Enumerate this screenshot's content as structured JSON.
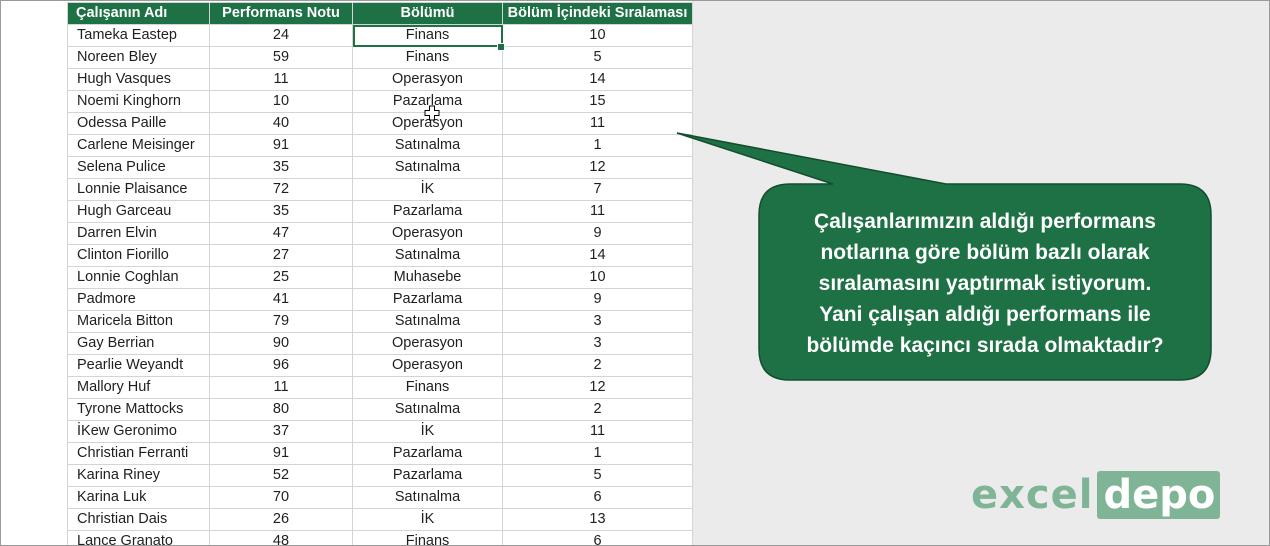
{
  "table": {
    "headers": [
      "Çalışanın Adı",
      "Performans Notu",
      "Bölümü",
      "Bölüm İçindeki Sıralaması"
    ],
    "rows": [
      [
        "Tameka Eastep",
        "24",
        "Finans",
        "10"
      ],
      [
        "Noreen Bley",
        "59",
        "Finans",
        "5"
      ],
      [
        "Hugh Vasques",
        "11",
        "Operasyon",
        "14"
      ],
      [
        "Noemi Kinghorn",
        "10",
        "Pazarlama",
        "15"
      ],
      [
        "Odessa Paille",
        "40",
        "Operasyon",
        "11"
      ],
      [
        "Carlene Meisinger",
        "91",
        "Satınalma",
        "1"
      ],
      [
        "Selena Pulice",
        "35",
        "Satınalma",
        "12"
      ],
      [
        "Lonnie Plaisance",
        "72",
        "İK",
        "7"
      ],
      [
        "Hugh Garceau",
        "35",
        "Pazarlama",
        "11"
      ],
      [
        "Darren Elvin",
        "47",
        "Operasyon",
        "9"
      ],
      [
        "Clinton Fiorillo",
        "27",
        "Satınalma",
        "14"
      ],
      [
        "Lonnie Coghlan",
        "25",
        "Muhasebe",
        "10"
      ],
      [
        "Padmore",
        "41",
        "Pazarlama",
        "9"
      ],
      [
        "Maricela Bitton",
        "79",
        "Satınalma",
        "3"
      ],
      [
        "Gay Berrian",
        "90",
        "Operasyon",
        "3"
      ],
      [
        "Pearlie Weyandt",
        "96",
        "Operasyon",
        "2"
      ],
      [
        "Mallory Huf",
        "11",
        "Finans",
        "12"
      ],
      [
        "Tyrone Mattocks",
        "80",
        "Satınalma",
        "2"
      ],
      [
        "İKew Geronimo",
        "37",
        "İK",
        "11"
      ],
      [
        "Christian Ferranti",
        "91",
        "Pazarlama",
        "1"
      ],
      [
        "Karina Riney",
        "52",
        "Pazarlama",
        "5"
      ],
      [
        "Karina Luk",
        "70",
        "Satınalma",
        "6"
      ],
      [
        "Christian Dais",
        "26",
        "İK",
        "13"
      ],
      [
        "Lance Granato",
        "48",
        "Finans",
        "6"
      ]
    ],
    "selected_row": 0,
    "selected_col": 2
  },
  "callout": {
    "text": "Çalışanlarımızın aldığı performans\nnotlarına göre bölüm bazlı olarak\nsıralamasını yaptırmak istiyorum.\nYani çalışan aldığı performans ile\nbölümde kaçıncı sırada olmaktadır?",
    "fill": "#1e7145",
    "stroke": "#134d2e"
  },
  "logo": {
    "part1": "excel",
    "part2": "depo",
    "color": "#7fb596"
  },
  "colors": {
    "header_bg": "#1e7145",
    "grid": "#d4d4d4",
    "outside_bg": "#ebebeb"
  },
  "icons": {
    "cursor": "cell-select-cursor-icon"
  }
}
